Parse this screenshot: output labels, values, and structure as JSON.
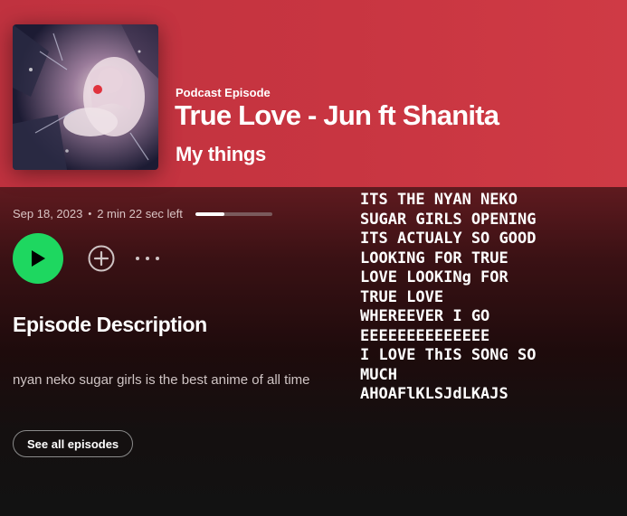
{
  "episode": {
    "type_label": "Podcast Episode",
    "title": "True Love - Jun ft Shanita",
    "show": "My things",
    "date": "Sep 18, 2023",
    "separator": "•",
    "time_left": "2 min 22 sec left",
    "progress_fraction": 0.38,
    "description_heading": "Episode Description",
    "description": "nyan neko sugar girls is the best anime of all time"
  },
  "actions": {
    "play_icon": "play-icon",
    "add_icon": "add-circle-icon",
    "more_icon": "more-horizontal-icon",
    "see_all_label": "See all episodes"
  },
  "lyrics_image_lines": [
    "ITS THE NYAN NEKO",
    "SUGAR GIRLS OPENING",
    "ITS ACTUALY SO GOOD",
    "LOOKING FOR TRUE",
    "LOVE LOOKINg FOR",
    "TRUE LOVE",
    "WHEREEVER I GO",
    "EEEEEEEEEEEEEE",
    "I LOVE ThIS SONG SO",
    "MUCH",
    "AHOAFlKLSJdLKAJS"
  ],
  "colors": {
    "header_red": "#c83541",
    "play_green": "#1ed760",
    "background": "#121212"
  }
}
